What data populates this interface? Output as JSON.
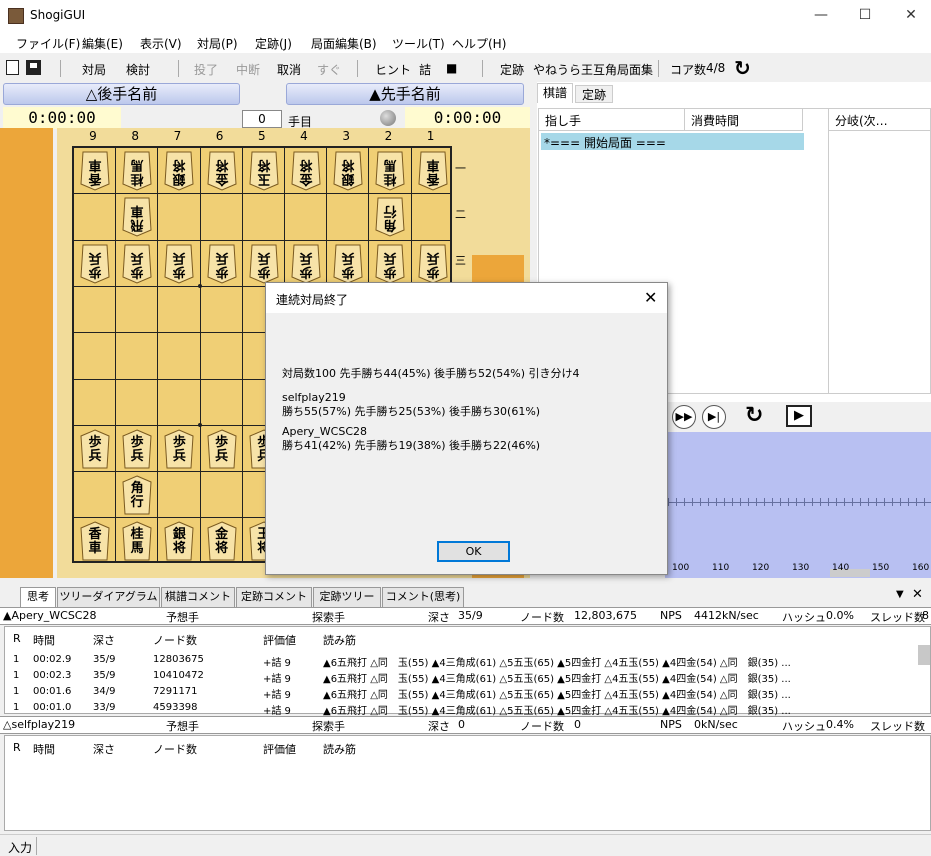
{
  "window": {
    "title": "ShogiGUI",
    "minimize": "—",
    "maximize": "☐",
    "close": "✕"
  },
  "menu": [
    "ファイル(F)",
    "編集(E)",
    "表示(V)",
    "対局(P)",
    "定跡(J)",
    "局面編集(B)",
    "ツール(T)",
    "ヘルプ(H)"
  ],
  "toolbar": {
    "play": "対局",
    "study": "検討",
    "resign": "投了",
    "suspend": "中断",
    "undo": "取消",
    "now": "すぐ",
    "hint": "ヒント",
    "mate": "詰",
    "stop": "■",
    "joseki_label": "定跡",
    "joseki_value": "やねうら王互角局面集",
    "cores_label": "コア数",
    "cores_value": "4/8",
    "refresh": "↻"
  },
  "players": {
    "gote_name": "△後手名前",
    "sente_name": "▲先手名前",
    "gote_time": "0:00:00",
    "sente_time": "0:00:00",
    "move_no": "0",
    "move_unit": "手目"
  },
  "board": {
    "files": [
      "9",
      "8",
      "7",
      "6",
      "5",
      "4",
      "3",
      "2",
      "1"
    ],
    "ranks": [
      "一",
      "二",
      "三"
    ],
    "gote_pieces": [
      {
        "f": 0,
        "r": 0,
        "t": "香車"
      },
      {
        "f": 1,
        "r": 0,
        "t": "桂馬"
      },
      {
        "f": 2,
        "r": 0,
        "t": "銀将"
      },
      {
        "f": 3,
        "r": 0,
        "t": "金将"
      },
      {
        "f": 4,
        "r": 0,
        "t": "玉将"
      },
      {
        "f": 5,
        "r": 0,
        "t": "金将"
      },
      {
        "f": 6,
        "r": 0,
        "t": "銀将"
      },
      {
        "f": 7,
        "r": 0,
        "t": "桂馬"
      },
      {
        "f": 8,
        "r": 0,
        "t": "香車"
      },
      {
        "f": 1,
        "r": 1,
        "t": "飛車"
      },
      {
        "f": 7,
        "r": 1,
        "t": "角行"
      },
      {
        "f": 0,
        "r": 2,
        "t": "歩兵"
      },
      {
        "f": 1,
        "r": 2,
        "t": "歩兵"
      },
      {
        "f": 2,
        "r": 2,
        "t": "歩兵"
      },
      {
        "f": 3,
        "r": 2,
        "t": "歩兵"
      },
      {
        "f": 4,
        "r": 2,
        "t": "歩兵"
      },
      {
        "f": 5,
        "r": 2,
        "t": "歩兵"
      },
      {
        "f": 6,
        "r": 2,
        "t": "歩兵"
      },
      {
        "f": 7,
        "r": 2,
        "t": "歩兵"
      },
      {
        "f": 8,
        "r": 2,
        "t": "歩兵"
      }
    ],
    "sente_pieces": [
      {
        "f": 0,
        "r": 6,
        "t": "歩兵"
      },
      {
        "f": 1,
        "r": 6,
        "t": "歩兵"
      },
      {
        "f": 2,
        "r": 6,
        "t": "歩兵"
      },
      {
        "f": 3,
        "r": 6,
        "t": "歩兵"
      },
      {
        "f": 4,
        "r": 6,
        "t": "歩兵"
      },
      {
        "f": 1,
        "r": 7,
        "t": "角行"
      },
      {
        "f": 0,
        "r": 8,
        "t": "香車"
      },
      {
        "f": 1,
        "r": 8,
        "t": "桂馬"
      },
      {
        "f": 2,
        "r": 8,
        "t": "銀将"
      },
      {
        "f": 3,
        "r": 8,
        "t": "金将"
      },
      {
        "f": 4,
        "r": 8,
        "t": "玉将"
      }
    ]
  },
  "kifu": {
    "tabs": [
      "棋譜",
      "定跡"
    ],
    "col_move": "指し手",
    "col_time": "消費時間",
    "col_branch": "分岐(次…",
    "first_row": "*=== 開始局面 ==="
  },
  "eval_axis": [
    "100",
    "110",
    "120",
    "130",
    "140",
    "150",
    "160"
  ],
  "controls": {
    "ffwd": "▶▶",
    "last": "▶|",
    "flip": "↻",
    "play": "▶"
  },
  "dialog": {
    "title": "連続対局終了",
    "summary": "対局数100 先手勝ち44(45%) 後手勝ち52(54%) 引き分け4",
    "p1_name": "selfplay219",
    "p1_stats": "勝ち55(57%) 先手勝ち25(53%) 後手勝ち30(61%)",
    "p2_name": "Apery_WCSC28",
    "p2_stats": "勝ち41(42%) 先手勝ち19(38%) 後手勝ち22(46%)",
    "ok": "OK"
  },
  "bottom_tabs": [
    "思考",
    "ツリーダイアグラム",
    "棋譜コメント",
    "定跡コメント",
    "定跡ツリー",
    "コメント(思考)"
  ],
  "engine1": {
    "name": "▲Apery_WCSC28",
    "pred_label": "予想手",
    "search_label": "探索手",
    "depth_label": "深さ",
    "depth": "35/9",
    "nodes_label": "ノード数",
    "nodes": "12,803,675",
    "nps_label": "NPS",
    "nps": "4412kN/sec",
    "hash_label": "ハッシュ",
    "hash": "0.0%",
    "threads_label": "スレッド数",
    "threads": "8",
    "headers": [
      "R",
      "時間",
      "深さ",
      "ノード数",
      "評価値",
      "読み筋"
    ],
    "rows": [
      [
        "1",
        "00:02.9",
        "35/9",
        "12803675",
        "+詰 9",
        "▲6五飛打 △同　玉(55) ▲4三角成(61) △5五玉(65) ▲5四金打 △4五玉(55) ▲4四金(54) △同　銀(35) ..."
      ],
      [
        "1",
        "00:02.3",
        "35/9",
        "10410472",
        "+詰 9",
        "▲6五飛打 △同　玉(55) ▲4三角成(61) △5五玉(65) ▲5四金打 △4五玉(55) ▲4四金(54) △同　銀(35) ..."
      ],
      [
        "1",
        "00:01.6",
        "34/9",
        "7291171",
        "+詰 9",
        "▲6五飛打 △同　玉(55) ▲4三角成(61) △5五玉(65) ▲5四金打 △4五玉(55) ▲4四金(54) △同　銀(35) ..."
      ],
      [
        "1",
        "00:01.0",
        "33/9",
        "4593398",
        "+詰 9",
        "▲6五飛打 △同　玉(55) ▲4三角成(61) △5五玉(65) ▲5四金打 △4五玉(55) ▲4四金(54) △同　銀(35) ..."
      ]
    ]
  },
  "engine2": {
    "name": "△selfplay219",
    "pred_label": "予想手",
    "search_label": "探索手",
    "depth_label": "深さ",
    "depth": "0",
    "nodes_label": "ノード数",
    "nodes": "0",
    "nps_label": "NPS",
    "nps": "0kN/sec",
    "hash_label": "ハッシュ",
    "hash": "0.4%",
    "threads_label": "スレッド数",
    "threads": "",
    "headers": [
      "R",
      "時間",
      "深さ",
      "ノード数",
      "評価値",
      "読み筋"
    ]
  },
  "status": {
    "input": "入力"
  },
  "colors": {
    "hand": "#eca63a",
    "board": "#f0cf75",
    "eval_bg": "#b8c0f2",
    "kifu_sel": "#a6d8e8"
  }
}
